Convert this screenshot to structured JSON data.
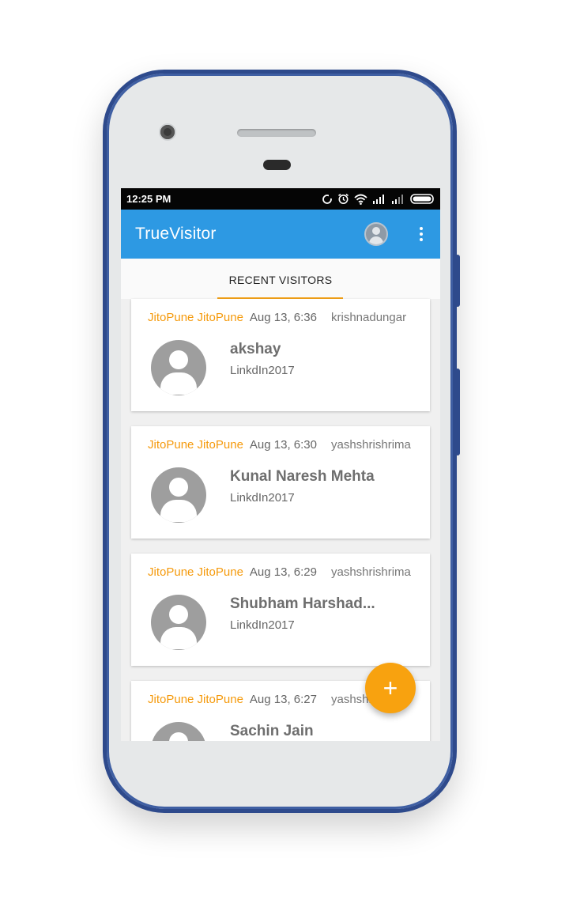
{
  "status_bar": {
    "time": "12:25 PM",
    "icons": [
      "sync-icon",
      "alarm-icon",
      "wifi-icon",
      "signal-icon",
      "signal-weak-icon",
      "battery-icon"
    ]
  },
  "app_bar": {
    "title": "TrueVisitor",
    "icons": [
      "account-icon",
      "more-vert-icon"
    ]
  },
  "tabs": [
    {
      "label": "RECENT VISITORS",
      "selected": true
    }
  ],
  "visitors": [
    {
      "org": "JitoPune JitoPune",
      "time": "Aug 13, 6:36",
      "user": "krishnadungar",
      "name": "akshay",
      "event": "LinkdIn2017"
    },
    {
      "org": "JitoPune JitoPune",
      "time": "Aug 13, 6:30",
      "user": "yashshrishrima",
      "name": "Kunal Naresh Mehta",
      "event": "LinkdIn2017"
    },
    {
      "org": "JitoPune JitoPune",
      "time": "Aug 13, 6:29",
      "user": "yashshrishrima",
      "name": "Shubham Harshad...",
      "event": "LinkdIn2017"
    },
    {
      "org": "JitoPune JitoPune",
      "time": "Aug 13, 6:27",
      "user": "yashshrishrima",
      "name": "Sachin Jain",
      "event": ""
    }
  ],
  "fab": {
    "label": "+",
    "icon": "add-icon"
  },
  "colors": {
    "app_bar": "#2d99e3",
    "accent": "#f59a0c",
    "phone_frame": "#2e4a8c"
  }
}
